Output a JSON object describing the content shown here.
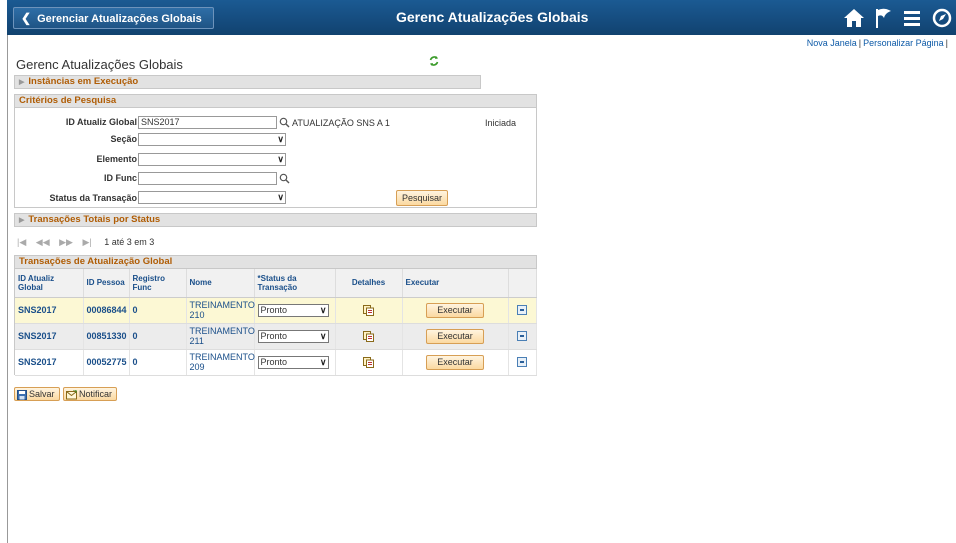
{
  "header": {
    "back_label": "Gerenciar Atualizações Globais",
    "title": "Gerenc Atualizações Globais",
    "icons": [
      "home-icon",
      "flag-icon",
      "menu-icon",
      "navbar-icon"
    ]
  },
  "links": {
    "new_window": "Nova Janela",
    "separator": "|",
    "personalize": "Personalizar Página",
    "trailing_separator": "|"
  },
  "page_title": "Gerenc Atualizações Globais",
  "sections": {
    "running_instances": "Instâncias em Execução",
    "search_criteria": "Critérios de Pesquisa",
    "totals_by_status": "Transações Totais por Status"
  },
  "search": {
    "global_update_id_label": "ID Atualiz Global",
    "global_update_id_value": "SNS2017",
    "global_update_description": "ATUALIZAÇÃO SNS A 1",
    "status": "Iniciada",
    "section_label": "Seção",
    "element_label": "Elemento",
    "employee_id_label": "ID Func",
    "transaction_status_label": "Status da Transação",
    "search_button": "Pesquisar"
  },
  "pager": {
    "first": "|◀",
    "prev": "◀◀",
    "next": "▶▶",
    "last": "▶|",
    "count": "1 até 3 em 3"
  },
  "grid": {
    "title": "Transações de Atualização Global",
    "columns": {
      "global_id": "ID Atualiz Global",
      "person_id": "ID Pessoa",
      "emp_record": "Registro Func",
      "name": "Nome",
      "status": "*Status da Transação",
      "details": "Detalhes",
      "execute": "Executar"
    },
    "rows": [
      {
        "global_id": "SNS2017",
        "person_id": "00086844",
        "emp_record": "0",
        "name_line1": "TREINAMENTO",
        "name_line2": "210",
        "status": "Pronto",
        "execute": "Executar"
      },
      {
        "global_id": "SNS2017",
        "person_id": "00851330",
        "emp_record": "0",
        "name_line1": "TREINAMENTO",
        "name_line2": "211",
        "status": "Pronto",
        "execute": "Executar"
      },
      {
        "global_id": "SNS2017",
        "person_id": "00052775",
        "emp_record": "0",
        "name_line1": "TREINAMENTO",
        "name_line2": "209",
        "status": "Pronto",
        "execute": "Executar"
      }
    ]
  },
  "footer": {
    "save": "Salvar",
    "notify": "Notificar"
  }
}
